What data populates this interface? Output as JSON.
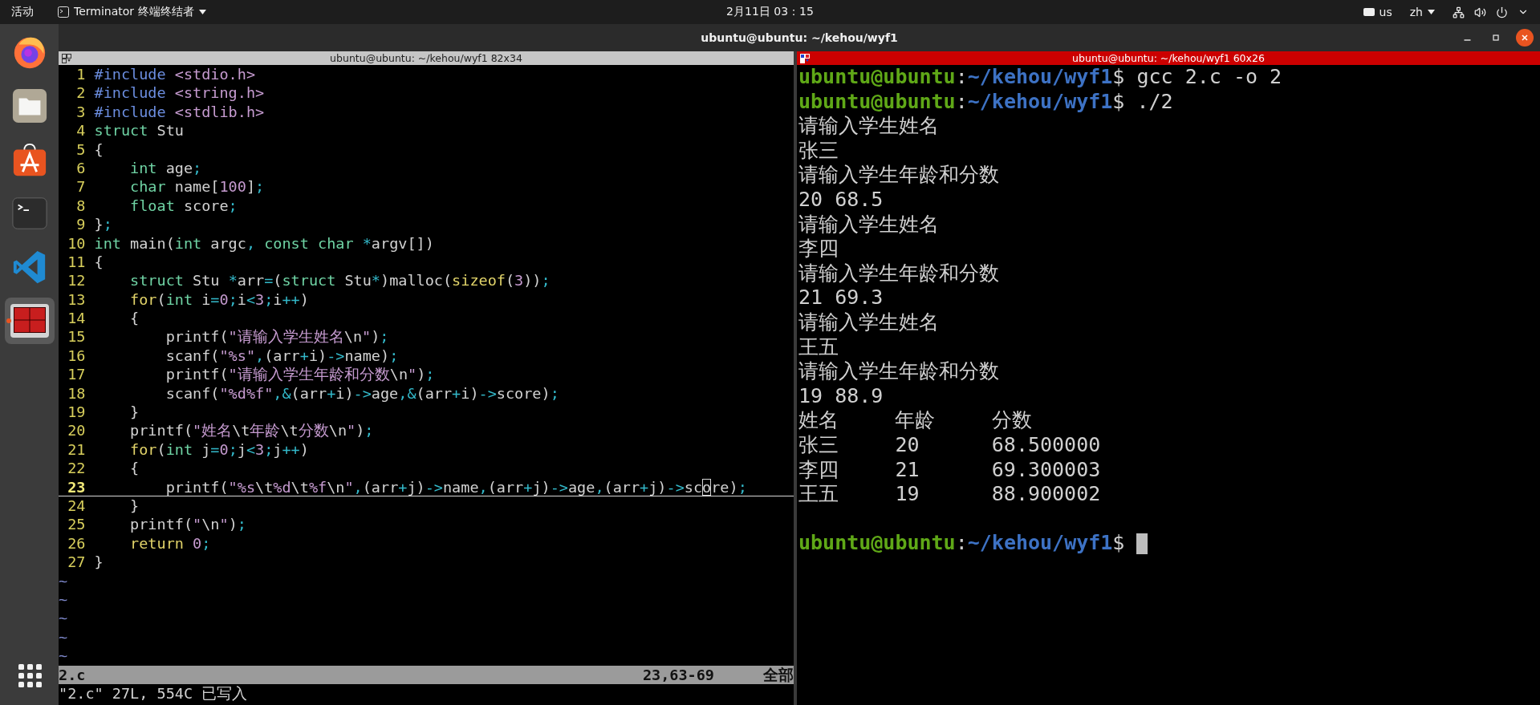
{
  "top_bar": {
    "activities": "活动",
    "app_menu": "Terminator 终端终结者",
    "clock": "2月11日 03：15",
    "keyboard_layout": "us",
    "input_method": "zh"
  },
  "dock": {
    "apps": [
      {
        "kind": "browser",
        "selected": false,
        "running": false
      },
      {
        "kind": "files",
        "selected": false,
        "running": false
      },
      {
        "kind": "store",
        "selected": false,
        "running": false
      },
      {
        "kind": "terminal",
        "selected": false,
        "running": false
      },
      {
        "kind": "editor",
        "selected": false,
        "running": false
      },
      {
        "kind": "terminator",
        "selected": true,
        "running": true
      }
    ]
  },
  "window": {
    "title": "ubuntu@ubuntu: ~/kehou/wyf1"
  },
  "panes": [
    {
      "title": "ubuntu@ubuntu: ~/kehou/wyf1 82x34",
      "active": false
    },
    {
      "title": "ubuntu@ubuntu: ~/kehou/wyf1 60x26",
      "active": true
    }
  ],
  "editor": {
    "lines": [
      {
        "number": "1",
        "current": false,
        "tokens": [
          {
            "kind": "pre",
            "text": "#include"
          },
          {
            "kind": "inc",
            "text": " <stdio.h>"
          }
        ]
      },
      {
        "number": "2",
        "current": false,
        "tokens": [
          {
            "kind": "pre",
            "text": "#include"
          },
          {
            "kind": "inc",
            "text": " <string.h>"
          }
        ]
      },
      {
        "number": "3",
        "current": false,
        "tokens": [
          {
            "kind": "pre",
            "text": "#include"
          },
          {
            "kind": "inc",
            "text": " <stdlib.h>"
          }
        ]
      },
      {
        "number": "4",
        "current": false,
        "tokens": [
          {
            "kind": "type",
            "text": "struct"
          },
          {
            "kind": "plain",
            "text": " Stu"
          }
        ]
      },
      {
        "number": "5",
        "current": false,
        "tokens": [
          {
            "kind": "plain",
            "text": "{"
          }
        ]
      },
      {
        "number": "6",
        "current": false,
        "tokens": [
          {
            "kind": "type",
            "text": "    int"
          },
          {
            "kind": "plain",
            "text": " age"
          },
          {
            "kind": "op",
            "text": ";"
          }
        ]
      },
      {
        "number": "7",
        "current": false,
        "tokens": [
          {
            "kind": "type",
            "text": "    char"
          },
          {
            "kind": "plain",
            "text": " name["
          },
          {
            "kind": "num",
            "text": "100"
          },
          {
            "kind": "plain",
            "text": "]"
          },
          {
            "kind": "op",
            "text": ";"
          }
        ]
      },
      {
        "number": "8",
        "current": false,
        "tokens": [
          {
            "kind": "type",
            "text": "    float"
          },
          {
            "kind": "plain",
            "text": " score"
          },
          {
            "kind": "op",
            "text": ";"
          }
        ]
      },
      {
        "number": "9",
        "current": false,
        "tokens": [
          {
            "kind": "plain",
            "text": "}"
          },
          {
            "kind": "op",
            "text": ";"
          }
        ]
      },
      {
        "number": "10",
        "current": false,
        "tokens": [
          {
            "kind": "type",
            "text": "int"
          },
          {
            "kind": "plain",
            "text": " main("
          },
          {
            "kind": "type",
            "text": "int"
          },
          {
            "kind": "plain",
            "text": " argc"
          },
          {
            "kind": "op",
            "text": ","
          },
          {
            "kind": "type",
            "text": " const"
          },
          {
            "kind": "type",
            "text": " char"
          },
          {
            "kind": "op",
            "text": " *"
          },
          {
            "kind": "plain",
            "text": "argv[])"
          }
        ]
      },
      {
        "number": "11",
        "current": false,
        "tokens": [
          {
            "kind": "plain",
            "text": "{"
          }
        ]
      },
      {
        "number": "12",
        "current": false,
        "tokens": [
          {
            "kind": "type",
            "text": "    struct"
          },
          {
            "kind": "plain",
            "text": " Stu "
          },
          {
            "kind": "op",
            "text": "*"
          },
          {
            "kind": "plain",
            "text": "arr"
          },
          {
            "kind": "op",
            "text": "="
          },
          {
            "kind": "plain",
            "text": "("
          },
          {
            "kind": "type",
            "text": "struct"
          },
          {
            "kind": "plain",
            "text": " Stu"
          },
          {
            "kind": "op",
            "text": "*"
          },
          {
            "kind": "plain",
            "text": ")malloc("
          },
          {
            "kind": "kw",
            "text": "sizeof"
          },
          {
            "kind": "plain",
            "text": "("
          },
          {
            "kind": "num",
            "text": "3"
          },
          {
            "kind": "plain",
            "text": "))"
          },
          {
            "kind": "op",
            "text": ";"
          }
        ]
      },
      {
        "number": "13",
        "current": false,
        "tokens": [
          {
            "kind": "kw",
            "text": "    for"
          },
          {
            "kind": "plain",
            "text": "("
          },
          {
            "kind": "type",
            "text": "int"
          },
          {
            "kind": "plain",
            "text": " i"
          },
          {
            "kind": "op",
            "text": "="
          },
          {
            "kind": "num",
            "text": "0"
          },
          {
            "kind": "op",
            "text": ";"
          },
          {
            "kind": "plain",
            "text": "i"
          },
          {
            "kind": "op",
            "text": "<"
          },
          {
            "kind": "num",
            "text": "3"
          },
          {
            "kind": "op",
            "text": ";"
          },
          {
            "kind": "plain",
            "text": "i"
          },
          {
            "kind": "op",
            "text": "++"
          },
          {
            "kind": "plain",
            "text": ")"
          }
        ]
      },
      {
        "number": "14",
        "current": false,
        "tokens": [
          {
            "kind": "plain",
            "text": "    {"
          }
        ]
      },
      {
        "number": "15",
        "current": false,
        "tokens": [
          {
            "kind": "plain",
            "text": "        printf("
          },
          {
            "kind": "str",
            "text": "\"请输入学生姓名"
          },
          {
            "kind": "plain",
            "text": "\\n"
          },
          {
            "kind": "str",
            "text": "\""
          },
          {
            "kind": "plain",
            "text": ")"
          },
          {
            "kind": "op",
            "text": ";"
          }
        ]
      },
      {
        "number": "16",
        "current": false,
        "tokens": [
          {
            "kind": "plain",
            "text": "        scanf("
          },
          {
            "kind": "str",
            "text": "\"%s\""
          },
          {
            "kind": "op",
            "text": ","
          },
          {
            "kind": "plain",
            "text": "(arr"
          },
          {
            "kind": "op",
            "text": "+"
          },
          {
            "kind": "plain",
            "text": "i)"
          },
          {
            "kind": "op",
            "text": "->"
          },
          {
            "kind": "plain",
            "text": "name)"
          },
          {
            "kind": "op",
            "text": ";"
          }
        ]
      },
      {
        "number": "17",
        "current": false,
        "tokens": [
          {
            "kind": "plain",
            "text": "        printf("
          },
          {
            "kind": "str",
            "text": "\"请输入学生年龄和分数"
          },
          {
            "kind": "plain",
            "text": "\\n"
          },
          {
            "kind": "str",
            "text": "\""
          },
          {
            "kind": "plain",
            "text": ")"
          },
          {
            "kind": "op",
            "text": ";"
          }
        ]
      },
      {
        "number": "18",
        "current": false,
        "tokens": [
          {
            "kind": "plain",
            "text": "        scanf("
          },
          {
            "kind": "str",
            "text": "\"%d%f\""
          },
          {
            "kind": "op",
            "text": ",&"
          },
          {
            "kind": "plain",
            "text": "(arr"
          },
          {
            "kind": "op",
            "text": "+"
          },
          {
            "kind": "plain",
            "text": "i)"
          },
          {
            "kind": "op",
            "text": "->"
          },
          {
            "kind": "plain",
            "text": "age"
          },
          {
            "kind": "op",
            "text": ",&"
          },
          {
            "kind": "plain",
            "text": "(arr"
          },
          {
            "kind": "op",
            "text": "+"
          },
          {
            "kind": "plain",
            "text": "i)"
          },
          {
            "kind": "op",
            "text": "->"
          },
          {
            "kind": "plain",
            "text": "score)"
          },
          {
            "kind": "op",
            "text": ";"
          }
        ]
      },
      {
        "number": "19",
        "current": false,
        "tokens": [
          {
            "kind": "plain",
            "text": "    }"
          }
        ]
      },
      {
        "number": "20",
        "current": false,
        "tokens": [
          {
            "kind": "plain",
            "text": "    printf("
          },
          {
            "kind": "str",
            "text": "\"姓名"
          },
          {
            "kind": "plain",
            "text": "\\t"
          },
          {
            "kind": "str",
            "text": "年龄"
          },
          {
            "kind": "plain",
            "text": "\\t"
          },
          {
            "kind": "str",
            "text": "分数"
          },
          {
            "kind": "plain",
            "text": "\\n"
          },
          {
            "kind": "str",
            "text": "\""
          },
          {
            "kind": "plain",
            "text": ")"
          },
          {
            "kind": "op",
            "text": ";"
          }
        ]
      },
      {
        "number": "21",
        "current": false,
        "tokens": [
          {
            "kind": "kw",
            "text": "    for"
          },
          {
            "kind": "plain",
            "text": "("
          },
          {
            "kind": "type",
            "text": "int"
          },
          {
            "kind": "plain",
            "text": " j"
          },
          {
            "kind": "op",
            "text": "="
          },
          {
            "kind": "num",
            "text": "0"
          },
          {
            "kind": "op",
            "text": ";"
          },
          {
            "kind": "plain",
            "text": "j"
          },
          {
            "kind": "op",
            "text": "<"
          },
          {
            "kind": "num",
            "text": "3"
          },
          {
            "kind": "op",
            "text": ";"
          },
          {
            "kind": "plain",
            "text": "j"
          },
          {
            "kind": "op",
            "text": "++"
          },
          {
            "kind": "plain",
            "text": ")"
          }
        ]
      },
      {
        "number": "22",
        "current": false,
        "tokens": [
          {
            "kind": "plain",
            "text": "    {"
          }
        ]
      },
      {
        "number": "23",
        "current": true,
        "tokens": [
          {
            "kind": "plain",
            "text": "        printf("
          },
          {
            "kind": "str",
            "text": "\"%s"
          },
          {
            "kind": "plain",
            "text": "\\t"
          },
          {
            "kind": "str",
            "text": "%d"
          },
          {
            "kind": "plain",
            "text": "\\t"
          },
          {
            "kind": "str",
            "text": "%f"
          },
          {
            "kind": "plain",
            "text": "\\n"
          },
          {
            "kind": "str",
            "text": "\""
          },
          {
            "kind": "op",
            "text": ","
          },
          {
            "kind": "plain",
            "text": "(arr"
          },
          {
            "kind": "op",
            "text": "+"
          },
          {
            "kind": "plain",
            "text": "j)"
          },
          {
            "kind": "op",
            "text": "->"
          },
          {
            "kind": "plain",
            "text": "name"
          },
          {
            "kind": "op",
            "text": ","
          },
          {
            "kind": "plain",
            "text": "(arr"
          },
          {
            "kind": "op",
            "text": "+"
          },
          {
            "kind": "plain",
            "text": "j)"
          },
          {
            "kind": "op",
            "text": "->"
          },
          {
            "kind": "plain",
            "text": "age"
          },
          {
            "kind": "op",
            "text": ","
          },
          {
            "kind": "plain",
            "text": "(arr"
          },
          {
            "kind": "op",
            "text": "+"
          },
          {
            "kind": "plain",
            "text": "j)"
          },
          {
            "kind": "op",
            "text": "->"
          },
          {
            "kind": "plain",
            "text": "sc"
          },
          {
            "kind": "plain",
            "text": "o",
            "cursor": true
          },
          {
            "kind": "plain",
            "text": "re)"
          },
          {
            "kind": "op",
            "text": ";"
          }
        ]
      },
      {
        "number": "24",
        "current": false,
        "tokens": [
          {
            "kind": "plain",
            "text": "    }"
          }
        ]
      },
      {
        "number": "25",
        "current": false,
        "tokens": [
          {
            "kind": "plain",
            "text": "    printf("
          },
          {
            "kind": "str",
            "text": "\""
          },
          {
            "kind": "plain",
            "text": "\\n"
          },
          {
            "kind": "str",
            "text": "\""
          },
          {
            "kind": "plain",
            "text": ")"
          },
          {
            "kind": "op",
            "text": ";"
          }
        ]
      },
      {
        "number": "26",
        "current": false,
        "tokens": [
          {
            "kind": "kw",
            "text": "    return"
          },
          {
            "kind": "num",
            "text": " 0"
          },
          {
            "kind": "op",
            "text": ";"
          }
        ]
      },
      {
        "number": "27",
        "current": false,
        "tokens": [
          {
            "kind": "plain",
            "text": "}"
          }
        ]
      }
    ],
    "tildes": [
      "~",
      "~",
      "~",
      "~",
      "~"
    ],
    "status": {
      "file": "2.c",
      "position": "23,63-69",
      "scroll": "全部"
    },
    "message": "\"2.c\" 27L, 554C 已写入"
  },
  "terminal": {
    "output": [
      {
        "kind": "prompt",
        "user": "ubuntu@ubuntu",
        "colon": ":",
        "path": "~/kehou/wyf1",
        "symbol": "$",
        "command": "gcc 2.c -o 2",
        "cursor": false
      },
      {
        "kind": "prompt",
        "user": "ubuntu@ubuntu",
        "colon": ":",
        "path": "~/kehou/wyf1",
        "symbol": "$",
        "command": "./2",
        "cursor": false
      },
      {
        "kind": "text",
        "text": "请输入学生姓名"
      },
      {
        "kind": "text",
        "text": "张三"
      },
      {
        "kind": "text",
        "text": "请输入学生年龄和分数"
      },
      {
        "kind": "text",
        "text": "20 68.5"
      },
      {
        "kind": "text",
        "text": "请输入学生姓名"
      },
      {
        "kind": "text",
        "text": "李四"
      },
      {
        "kind": "text",
        "text": "请输入学生年龄和分数"
      },
      {
        "kind": "text",
        "text": "21 69.3"
      },
      {
        "kind": "text",
        "text": "请输入学生姓名"
      },
      {
        "kind": "text",
        "text": "王五"
      },
      {
        "kind": "text",
        "text": "请输入学生年龄和分数"
      },
      {
        "kind": "text",
        "text": "19 88.9"
      },
      {
        "kind": "table_row",
        "cells": [
          "姓名",
          "年龄",
          "分数"
        ]
      },
      {
        "kind": "table_row",
        "cells": [
          "张三",
          "20",
          "68.500000"
        ]
      },
      {
        "kind": "table_row",
        "cells": [
          "李四",
          "21",
          "69.300003"
        ]
      },
      {
        "kind": "table_row",
        "cells": [
          "王五",
          "19",
          "88.900002"
        ]
      },
      {
        "kind": "blank"
      },
      {
        "kind": "prompt",
        "user": "ubuntu@ubuntu",
        "colon": ":",
        "path": "~/kehou/wyf1",
        "symbol": "$",
        "cursor": true
      }
    ]
  }
}
